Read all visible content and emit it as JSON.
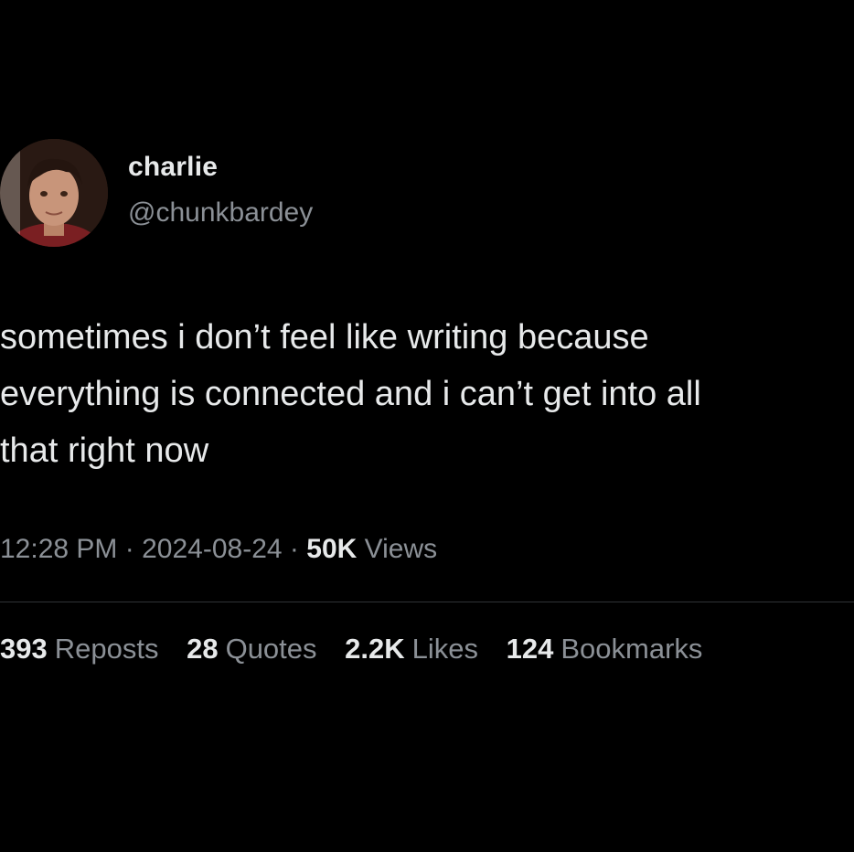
{
  "author": {
    "name": "charlie",
    "handle": "@chunkbardey"
  },
  "tweet": {
    "lines": [
      "sometimes i don’t feel like writing because",
      "everything is connected and i can’t get into all",
      "that right now"
    ],
    "time": "12:28 PM",
    "separator": "·",
    "date": "2024-08-24",
    "views_count": "50K",
    "views_label": "Views"
  },
  "stats": {
    "reposts": {
      "count": "393",
      "label": "Reposts"
    },
    "quotes": {
      "count": "28",
      "label": "Quotes"
    },
    "likes": {
      "count": "2.2K",
      "label": "Likes"
    },
    "bookmarks": {
      "count": "124",
      "label": "Bookmarks"
    }
  },
  "colors": {
    "background": "#000000",
    "primary_text": "#e7e9ea",
    "secondary_text": "#8b9096",
    "divider": "#2f3336"
  }
}
